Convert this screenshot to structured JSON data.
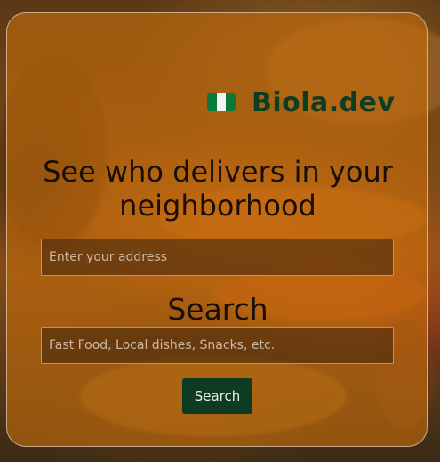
{
  "brand": {
    "name": "Biola.dev",
    "flag_icon": "nigeria-flag-icon",
    "flag_colors": [
      "#0a7a3a",
      "#f2f2f2",
      "#0a7a3a"
    ]
  },
  "headline": "See who delivers in your neighborhood",
  "address_input": {
    "value": "",
    "placeholder": "Enter your address"
  },
  "search_heading": "Search",
  "query_input": {
    "value": "",
    "placeholder": "Fast Food, Local dishes, Snacks, etc."
  },
  "search_button": {
    "label": "Search"
  },
  "colors": {
    "card_tint": "#c46c0c",
    "brand_text": "#0d3d22",
    "button_bg": "#0f3b22"
  }
}
